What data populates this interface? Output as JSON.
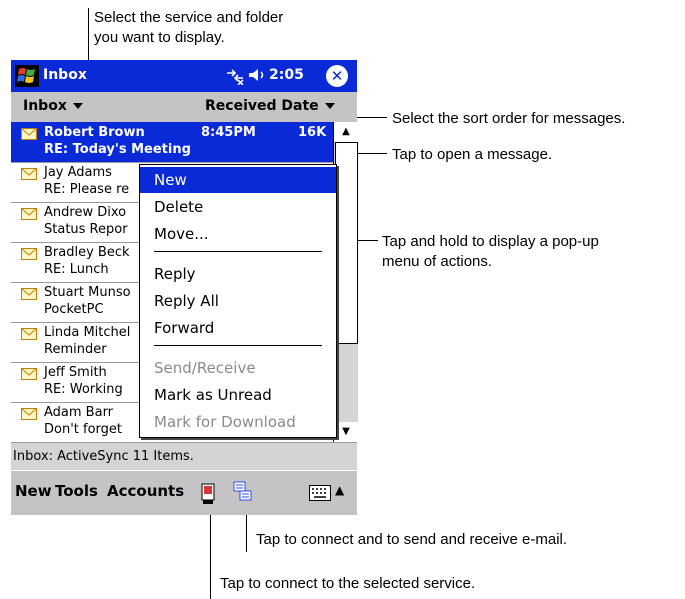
{
  "callouts": {
    "top_line1": "Select the service and folder",
    "top_line2": "you want to display.",
    "sort": "Select the sort order for messages.",
    "open": "Tap to open a message.",
    "hold_line1": "Tap and hold to display a pop-up",
    "hold_line2": "menu of actions.",
    "send_receive": "Tap to connect and to send and receive e-mail.",
    "connect": "Tap to connect to the selected service."
  },
  "titlebar": {
    "title": "Inbox",
    "time": "2:05",
    "close": "✕"
  },
  "sortbar": {
    "folder": "Inbox",
    "sort": "Received Date"
  },
  "messages": [
    {
      "from": "Robert Brown",
      "subject": "RE: Today's Meeting",
      "time": "8:45PM",
      "size": "16K"
    },
    {
      "from": "Jay Adams",
      "subject": "RE: Please re"
    },
    {
      "from": "Andrew Dixo",
      "subject": "Status Repor"
    },
    {
      "from": "Bradley Beck",
      "subject": "RE: Lunch"
    },
    {
      "from": "Stuart Munso",
      "subject": "PocketPC"
    },
    {
      "from": "Linda Mitchel",
      "subject": "Reminder"
    },
    {
      "from": "Jeff Smith",
      "subject": "RE: Working"
    },
    {
      "from": "Adam Barr",
      "subject": "Don't forget"
    }
  ],
  "menu": {
    "new": "New",
    "delete": "Delete",
    "move": "Move...",
    "reply": "Reply",
    "reply_all": "Reply All",
    "forward": "Forward",
    "send_receive": "Send/Receive",
    "mark_unread": "Mark as Unread",
    "mark_download": "Mark for Download"
  },
  "status": "Inbox: ActiveSync  11 Items.",
  "cmdbar": {
    "new": "New",
    "tools": "Tools",
    "accounts": "Accounts"
  },
  "colors": {
    "titlebar": "#0a2ad8",
    "bar": "#c6c3c6",
    "selection": "#0a2ad8"
  }
}
